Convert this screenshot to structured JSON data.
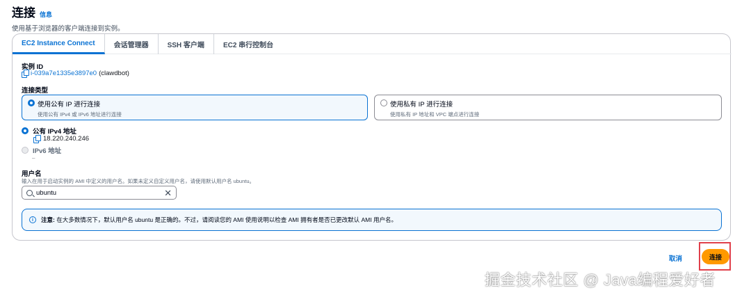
{
  "header": {
    "title": "连接",
    "info_link": "信息",
    "description": "使用基于浏览器的客户端连接到实例。"
  },
  "tabs": [
    {
      "label": "EC2 Instance Connect",
      "active": true
    },
    {
      "label": "会话管理器",
      "active": false
    },
    {
      "label": "SSH 客户端",
      "active": false
    },
    {
      "label": "EC2 串行控制台",
      "active": false
    }
  ],
  "instance": {
    "label": "实例 ID",
    "id": "i-039a7e1335e3897e0",
    "name": "(clawdbot)"
  },
  "connection_type": {
    "label": "连接类型",
    "options": [
      {
        "title": "使用公有 IP 进行连接",
        "subtitle": "使用公有 IPv4 或 IPv6 地址进行连接",
        "selected": true
      },
      {
        "title": "使用私有 IP 进行连接",
        "subtitle": "使用私有 IP 地址和 VPC 端点进行连接",
        "selected": false
      }
    ]
  },
  "ip": {
    "ipv4_label": "公有 IPv4 地址",
    "ipv4_value": "18.220.240.246",
    "ipv6_label": "IPv6 地址",
    "ipv6_value": "–"
  },
  "username": {
    "label": "用户名",
    "help": "输入在用于启动实例的 AMI 中定义的用户名。如果未定义自定义用户名，请使用默认用户名 ubuntu。",
    "value": "ubuntu"
  },
  "note": {
    "bold": "注意:",
    "text": "在大多数情况下，默认用户名 ubuntu 是正确的。不过，请阅读您的 AMI 使用说明以检查 AMI 拥有者是否已更改默认 AMI 用户名。"
  },
  "footer": {
    "cancel_label": "取消",
    "connect_label": "连接"
  },
  "watermark": "掘金技术社区 @ Java编程爱好者",
  "colors": {
    "accent": "#0972d3",
    "primary_button": "#ff9900",
    "highlight": "#e0404b"
  }
}
